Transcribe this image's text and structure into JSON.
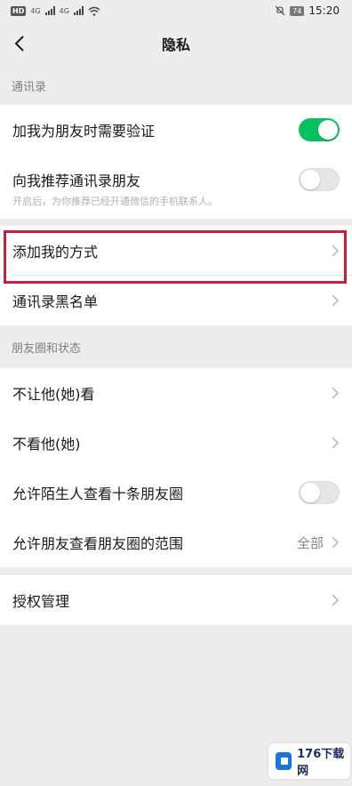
{
  "status_bar": {
    "left_badge": "HD",
    "net1": "4G",
    "net2": "4G",
    "battery": "74",
    "time": "15:20"
  },
  "nav": {
    "title": "隐私"
  },
  "sections": {
    "contacts_header": "通讯录",
    "moments_header": "朋友圈和状态"
  },
  "contacts": {
    "verify_label": "加我为朋友时需要验证",
    "verify_on": true,
    "recommend_label": "向我推荐通讯录朋友",
    "recommend_on": false,
    "recommend_hint": "开启后，为你推荐已经开通微信的手机联系人。",
    "add_methods_label": "添加我的方式",
    "blacklist_label": "通讯录黑名单"
  },
  "moments": {
    "hide_from_label": "不让他(她)看",
    "dont_see_label": "不看他(她)",
    "stranger_label": "允许陌生人查看十条朋友圈",
    "stranger_on": false,
    "range_label": "允许朋友查看朋友圈的范围",
    "range_value": "全部"
  },
  "authorization": {
    "label": "授权管理"
  },
  "watermark": {
    "text": "176下载网"
  },
  "colors": {
    "toggle_on": "#07c160",
    "highlight": "#c4213a"
  }
}
